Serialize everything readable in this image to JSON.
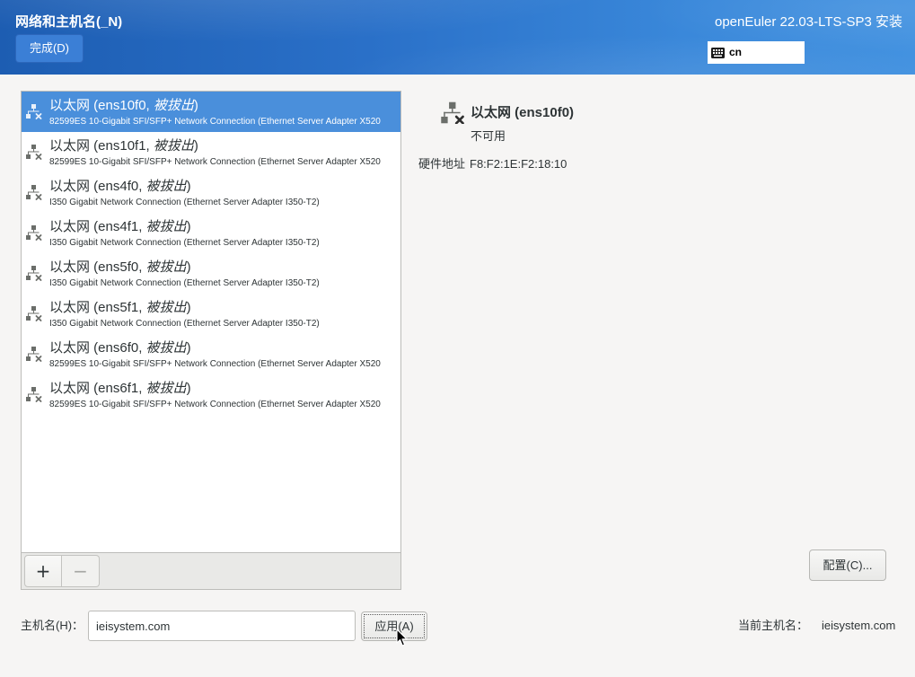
{
  "header": {
    "title": "网络和主机名(_N)",
    "done_label": "完成(D)",
    "product": "openEuler 22.03-LTS-SP3 安装",
    "keyboard": {
      "icon": "keyboard-icon",
      "layout": "cn"
    }
  },
  "devices": [
    {
      "label": "以太网 (ens10f0, ",
      "state": "被拔出",
      "label_end": ")",
      "description": "82599ES 10-Gigabit SFI/SFP+ Network Connection (Ethernet Server Adapter X520",
      "icon": "wired-network-disconnected-icon",
      "selected": true
    },
    {
      "label": "以太网 (ens10f1, ",
      "state": "被拔出",
      "label_end": ")",
      "description": "82599ES 10-Gigabit SFI/SFP+ Network Connection (Ethernet Server Adapter X520",
      "icon": "wired-network-disconnected-icon",
      "selected": false
    },
    {
      "label": "以太网 (ens4f0, ",
      "state": "被拔出",
      "label_end": ")",
      "description": "I350 Gigabit Network Connection (Ethernet Server Adapter I350-T2)",
      "icon": "wired-network-disconnected-icon",
      "selected": false
    },
    {
      "label": "以太网 (ens4f1, ",
      "state": "被拔出",
      "label_end": ")",
      "description": "I350 Gigabit Network Connection (Ethernet Server Adapter I350-T2)",
      "icon": "wired-network-disconnected-icon",
      "selected": false
    },
    {
      "label": "以太网 (ens5f0, ",
      "state": "被拔出",
      "label_end": ")",
      "description": "I350 Gigabit Network Connection (Ethernet Server Adapter I350-T2)",
      "icon": "wired-network-disconnected-icon",
      "selected": false
    },
    {
      "label": "以太网 (ens5f1, ",
      "state": "被拔出",
      "label_end": ")",
      "description": "I350 Gigabit Network Connection (Ethernet Server Adapter I350-T2)",
      "icon": "wired-network-disconnected-icon",
      "selected": false
    },
    {
      "label": "以太网 (ens6f0, ",
      "state": "被拔出",
      "label_end": ")",
      "description": "82599ES 10-Gigabit SFI/SFP+ Network Connection (Ethernet Server Adapter X520",
      "icon": "wired-network-disconnected-icon",
      "selected": false
    },
    {
      "label": "以太网 (ens6f1, ",
      "state": "被拔出",
      "label_end": ")",
      "description": "82599ES 10-Gigabit SFI/SFP+ Network Connection (Ethernet Server Adapter X520",
      "icon": "wired-network-disconnected-icon",
      "selected": false
    }
  ],
  "device_toolbar": {
    "add_label": "+",
    "remove_label": "−"
  },
  "details": {
    "icon": "wired-network-disconnected-icon",
    "title": "以太网 (ens10f0)",
    "status": "不可用",
    "hw_label": "硬件地址",
    "hw_value": "F8:F2:1E:F2:18:10",
    "configure_label": "配置(C)..."
  },
  "hostname": {
    "label": "主机名(H)：",
    "value": "ieisystem.com",
    "apply_label": "应用(A)",
    "current_label": "当前主机名：",
    "current_value": "ieisystem.com"
  },
  "cursor": {
    "icon": "mouse-pointer-icon"
  },
  "colors": {
    "header_start": "#1d5db2",
    "header_end": "#4392e0",
    "selection": "#4a8fdb",
    "background": "#f6f5f4"
  }
}
